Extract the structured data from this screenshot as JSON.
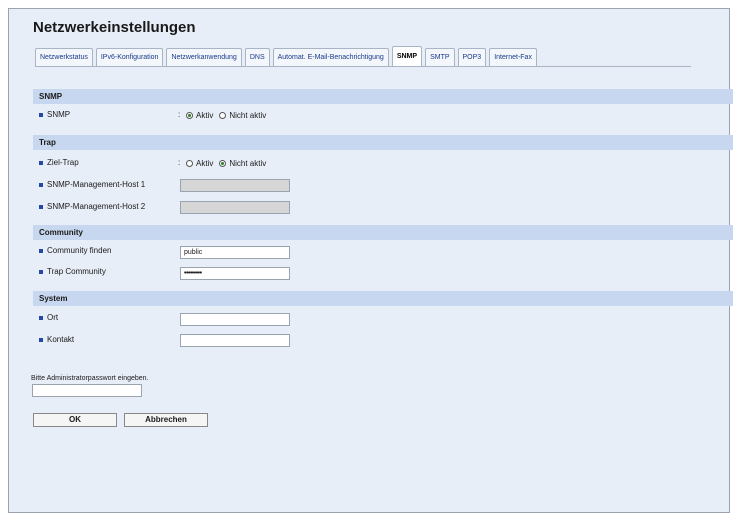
{
  "page": {
    "title": "Netzwerkeinstellungen"
  },
  "tabs": [
    {
      "label": "Netzwerkstatus"
    },
    {
      "label": "IPv6-Konfiguration"
    },
    {
      "label": "Netzwerkanwendung"
    },
    {
      "label": "DNS"
    },
    {
      "label": "Automat. E-Mail-Benachrichtigung"
    },
    {
      "label": "SNMP",
      "active": true
    },
    {
      "label": "SMTP"
    },
    {
      "label": "POP3"
    },
    {
      "label": "Internet-Fax"
    }
  ],
  "sections": {
    "snmp": {
      "title": "SNMP",
      "snmp_label": "SNMP",
      "colon": ":",
      "option_on": "Aktiv",
      "option_off": "Nicht aktiv",
      "selected": "Aktiv"
    },
    "trap": {
      "title": "Trap",
      "ziel_trap_label": "Ziel-Trap",
      "colon": ":",
      "option_on": "Aktiv",
      "option_off": "Nicht aktiv",
      "selected": "Nicht aktiv",
      "host1_label": "SNMP-Management-Host 1",
      "host2_label": "SNMP-Management-Host 2",
      "host1_value": "",
      "host2_value": ""
    },
    "community": {
      "title": "Community",
      "find_label": "Community finden",
      "find_value": "public",
      "trap_label": "Trap Community",
      "trap_value": "•••••••••"
    },
    "system": {
      "title": "System",
      "ort_label": "Ort",
      "ort_value": "",
      "kontakt_label": "Kontakt",
      "kontakt_value": ""
    }
  },
  "admin": {
    "prompt": "Bitte Administratorpasswort eingeben.",
    "password_value": ""
  },
  "buttons": {
    "ok": "OK",
    "cancel": "Abbrechen"
  },
  "colors": {
    "section_bg": "#c7d7ef",
    "frame_bg": "#e8eef7",
    "bullet": "#2448a8",
    "tab_text": "#1a3a8a"
  }
}
